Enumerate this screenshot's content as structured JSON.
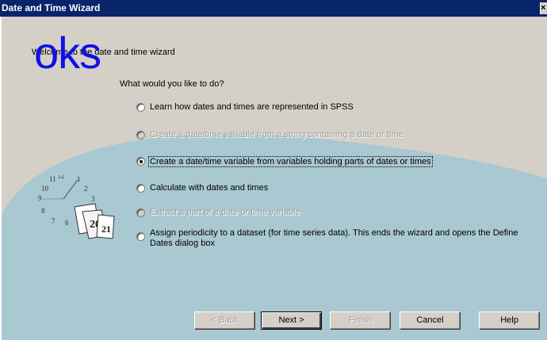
{
  "window": {
    "title": "Date and Time Wizard",
    "close_glyph": "×"
  },
  "watermark": {
    "text": "oks",
    "color": "#1010e6"
  },
  "welcome_text": "Welcome to the date and time wizard",
  "question": "What would you like to do?",
  "options": [
    {
      "label": "Learn how dates and times are represented in SPSS",
      "enabled": true,
      "selected": false
    },
    {
      "label": "Create a date/time variable from a string containing a date or time",
      "enabled": false,
      "selected": false
    },
    {
      "label": "Create a date/time variable from  variables holding parts of dates or times",
      "enabled": true,
      "selected": true
    },
    {
      "label": "Calculate with dates and times",
      "enabled": true,
      "selected": false
    },
    {
      "label": "Extract a part of a date or time variable",
      "enabled": false,
      "selected": false
    },
    {
      "label": "Assign periodicity to a dataset (for time series data). This ends the wizard and opens the Define Dates dialog box",
      "enabled": true,
      "selected": false
    }
  ],
  "clock": {
    "numbers": [
      "11",
      "12",
      "1",
      "10",
      "2",
      "9",
      "3",
      "8",
      "7",
      "6"
    ],
    "calendar_pages": [
      "20",
      "21"
    ]
  },
  "buttons": {
    "back": "< Back",
    "next": "Next >",
    "finish": "Finish",
    "cancel": "Cancel",
    "help": "Help"
  },
  "colors": {
    "title_bar": "#08246b",
    "dialog_bg": "#d4d0c8",
    "decoration_blob": "#a9c8d1"
  }
}
